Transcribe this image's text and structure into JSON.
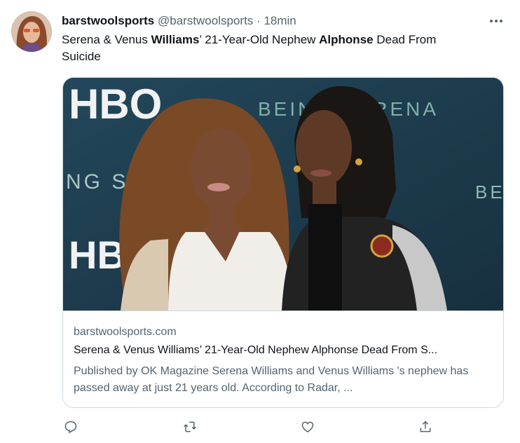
{
  "tweet": {
    "display_name": "barstwoolsports",
    "handle": "@barstwoolsports",
    "separator": "·",
    "time": "18min",
    "text_parts": [
      {
        "t": "Serena & Venus ",
        "b": false
      },
      {
        "t": "Williams",
        "b": true
      },
      {
        "t": "’ 21-Year-Old Nephew ",
        "b": false
      },
      {
        "t": "Alphonse",
        "b": true
      },
      {
        "t": " Dead From Suicide",
        "b": false
      }
    ]
  },
  "card": {
    "image_lettering": {
      "logo": "HBO",
      "backdrop_1": "BEING SERENA",
      "backdrop_2": "NG SE",
      "backdrop_3": "BE"
    },
    "domain": "barstwoolsports.com",
    "title": "Serena & Venus Williams’ 21-Year-Old Nephew Alphonse Dead From S...",
    "description": "Published by OK Magazine Serena Williams and Venus Williams 's nephew has passed away at just 21 years old. According to Radar, ..."
  },
  "icons": {
    "more": "more-horizontal-icon",
    "reply": "reply-icon",
    "retweet": "retweet-icon",
    "like": "heart-icon",
    "share": "share-icon"
  },
  "colors": {
    "text": "#0f1419",
    "secondary": "#536471",
    "border": "#cfd9de"
  }
}
